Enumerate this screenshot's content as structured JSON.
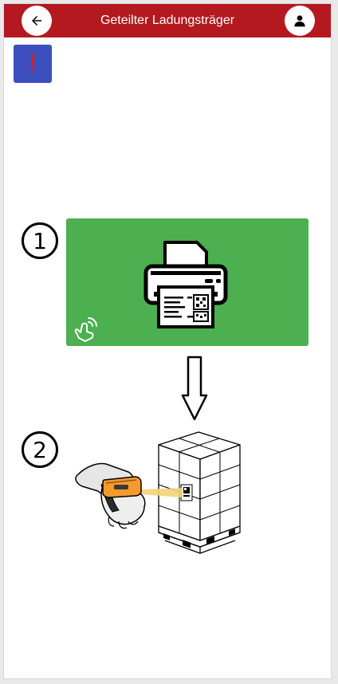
{
  "header": {
    "title": "Geteilter Ladungsträger",
    "back_icon": "arrow-left-icon",
    "user_icon": "user-icon"
  },
  "alert": {
    "mark": "!",
    "icon": "exclamation-icon"
  },
  "steps": [
    {
      "number": "1",
      "action": "print-label",
      "icon": "printer-icon"
    },
    {
      "number": "2",
      "action": "scan-pallet-label",
      "icon": "ring-scanner-icon"
    }
  ],
  "colors": {
    "header_bg": "#b3191f",
    "alert_bg": "#3b4fbf",
    "alert_mark": "#e21b1b",
    "print_tile_bg": "#4caf50",
    "scan_beam": "#f4d27a",
    "scanner_body": "#f39a2e"
  }
}
